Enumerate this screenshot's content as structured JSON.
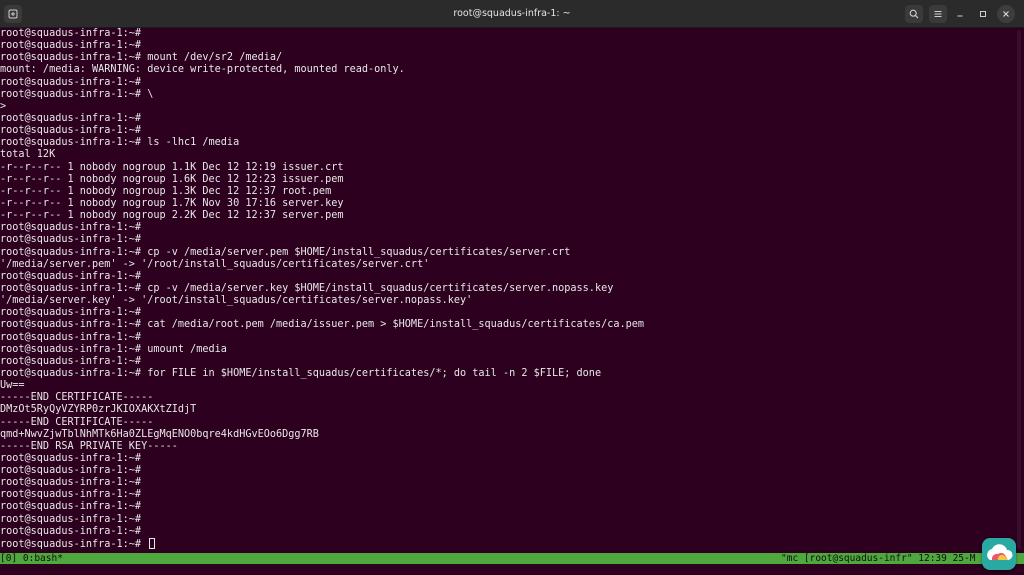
{
  "window": {
    "title": "root@squadus-infra-1: ~",
    "icons": {
      "new_tab": "new-tab-icon",
      "search": "search-icon",
      "menu": "hamburger-menu-icon",
      "minimize": "minimize-icon",
      "maximize": "maximize-icon",
      "close": "close-icon"
    }
  },
  "terminal": {
    "lines": [
      "root@squadus-infra-1:~#",
      "root@squadus-infra-1:~#",
      "root@squadus-infra-1:~# mount /dev/sr2 /media/",
      "mount: /media: WARNING: device write-protected, mounted read-only.",
      "root@squadus-infra-1:~#",
      "root@squadus-infra-1:~# \\",
      ">",
      "root@squadus-infra-1:~#",
      "root@squadus-infra-1:~#",
      "root@squadus-infra-1:~# ls -lhc1 /media",
      "total 12K",
      "-r--r--r-- 1 nobody nogroup 1.1K Dec 12 12:19 issuer.crt",
      "-r--r--r-- 1 nobody nogroup 1.6K Dec 12 12:23 issuer.pem",
      "-r--r--r-- 1 nobody nogroup 1.3K Dec 12 12:37 root.pem",
      "-r--r--r-- 1 nobody nogroup 1.7K Nov 30 17:16 server.key",
      "-r--r--r-- 1 nobody nogroup 2.2K Dec 12 12:37 server.pem",
      "root@squadus-infra-1:~#",
      "root@squadus-infra-1:~#",
      "root@squadus-infra-1:~# cp -v /media/server.pem $HOME/install_squadus/certificates/server.crt",
      "'/media/server.pem' -> '/root/install_squadus/certificates/server.crt'",
      "root@squadus-infra-1:~#",
      "root@squadus-infra-1:~# cp -v /media/server.key $HOME/install_squadus/certificates/server.nopass.key",
      "'/media/server.key' -> '/root/install_squadus/certificates/server.nopass.key'",
      "root@squadus-infra-1:~#",
      "root@squadus-infra-1:~# cat /media/root.pem /media/issuer.pem > $HOME/install_squadus/certificates/ca.pem",
      "root@squadus-infra-1:~#",
      "root@squadus-infra-1:~# umount /media",
      "root@squadus-infra-1:~#",
      "root@squadus-infra-1:~# for FILE in $HOME/install_squadus/certificates/*; do tail -n 2 $FILE; done",
      "Uw==",
      "-----END CERTIFICATE-----",
      "DMzOt5RyQyVZYRP0zrJKIOXAKXtZIdjT",
      "-----END CERTIFICATE-----",
      "qmd+NwvZjwTblNhMTk6Ha0ZLEgMqENO0bqre4kdHGvEOo6Dgg7RB",
      "-----END RSA PRIVATE KEY-----",
      "root@squadus-infra-1:~#",
      "root@squadus-infra-1:~#",
      "root@squadus-infra-1:~#",
      "root@squadus-infra-1:~#",
      "root@squadus-infra-1:~#",
      "root@squadus-infra-1:~#",
      "root@squadus-infra-1:~#",
      "root@squadus-infra-1:~#"
    ]
  },
  "status_bar": {
    "left": "[0] 0:bash*",
    "right": "\"mc [root@squadus-infr\" 12:39 25-M"
  },
  "colors": {
    "terminal_bg": "#2c001e",
    "status_bg": "#4fa83d",
    "titlebar_bg": "#2b2b2b"
  }
}
